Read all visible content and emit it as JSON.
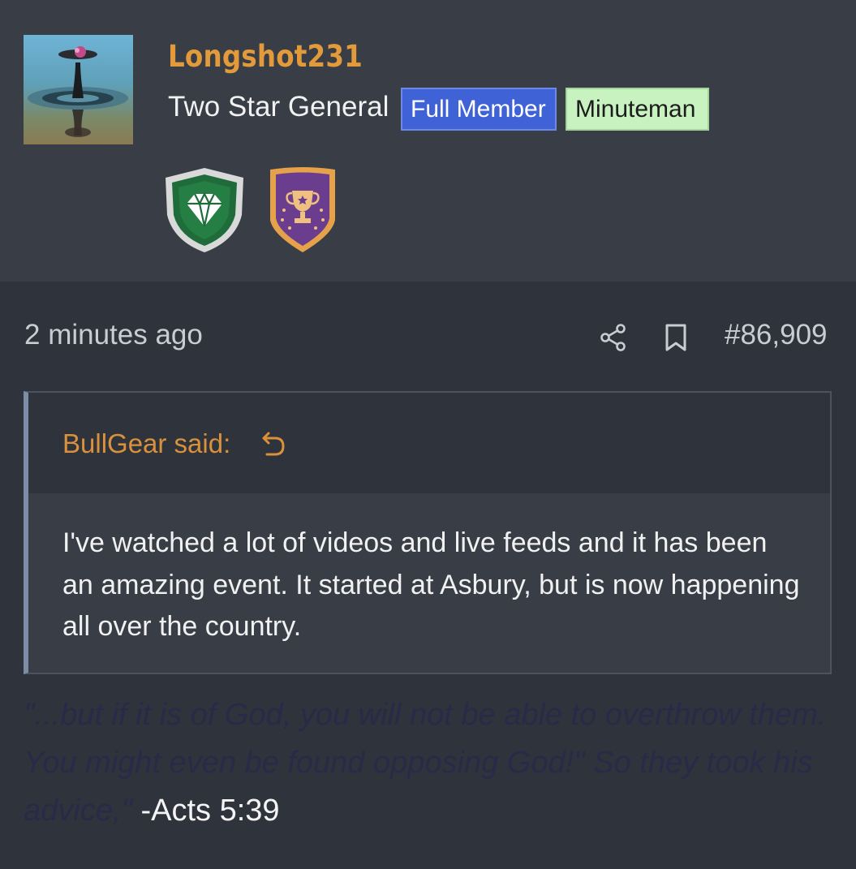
{
  "user": {
    "name": "Longshot231",
    "title": "Two Star General",
    "badges": [
      "Full Member",
      "Minuteman"
    ],
    "trophies": [
      "diamond-shield-trophy",
      "cup-shield-trophy"
    ]
  },
  "post": {
    "time": "2 minutes ago",
    "number": "#86,909",
    "icons": [
      "share-icon",
      "bookmark-icon"
    ]
  },
  "quote": {
    "author_label": "BullGear said:",
    "text": "I've watched a lot of videos and live feeds and it has been an amazing event. It started at Asbury, but is now happening all over the country."
  },
  "signature": {
    "quote": "\"...but if it is of God, you will not be able to overthrow them. You might even be found opposing God!\" So they took his advice,\"",
    "reference": "-Acts 5:39"
  },
  "colors": {
    "username": "#e29a3a",
    "badge_full_member": "#3f62d6",
    "badge_minuteman": "#c8f3c1",
    "quote_author": "#d9913b",
    "signature_quote": "#262b48"
  }
}
